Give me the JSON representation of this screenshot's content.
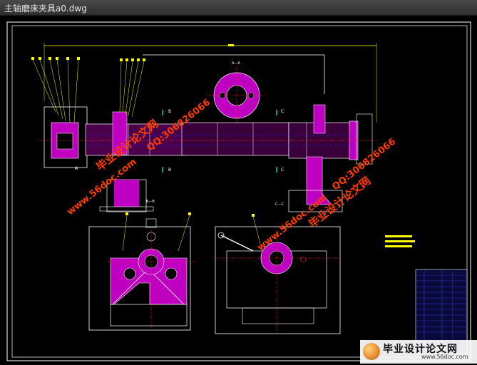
{
  "window": {
    "title": "主轴磨床夹具a0.dwg"
  },
  "watermarks": {
    "brand_cn": "毕业设计论文网",
    "qq": "QQ:306826066",
    "site": "www.56doc.com"
  },
  "drawing": {
    "section_labels": [
      "A—A",
      "B—B",
      "C—C"
    ],
    "letters": [
      "A",
      "B",
      "C"
    ]
  },
  "footer_logo": {
    "text": "毕业设计论文网",
    "site": "www.56doc.com"
  },
  "colors": {
    "background": "#000000",
    "frame": "#ffffff",
    "part_fill": "#c000c0",
    "dimension": "#ffff00",
    "centerline": "#ff2020",
    "hidden": "#2020ff",
    "section_line": "#00ffff",
    "watermark": "#ff3b00"
  }
}
